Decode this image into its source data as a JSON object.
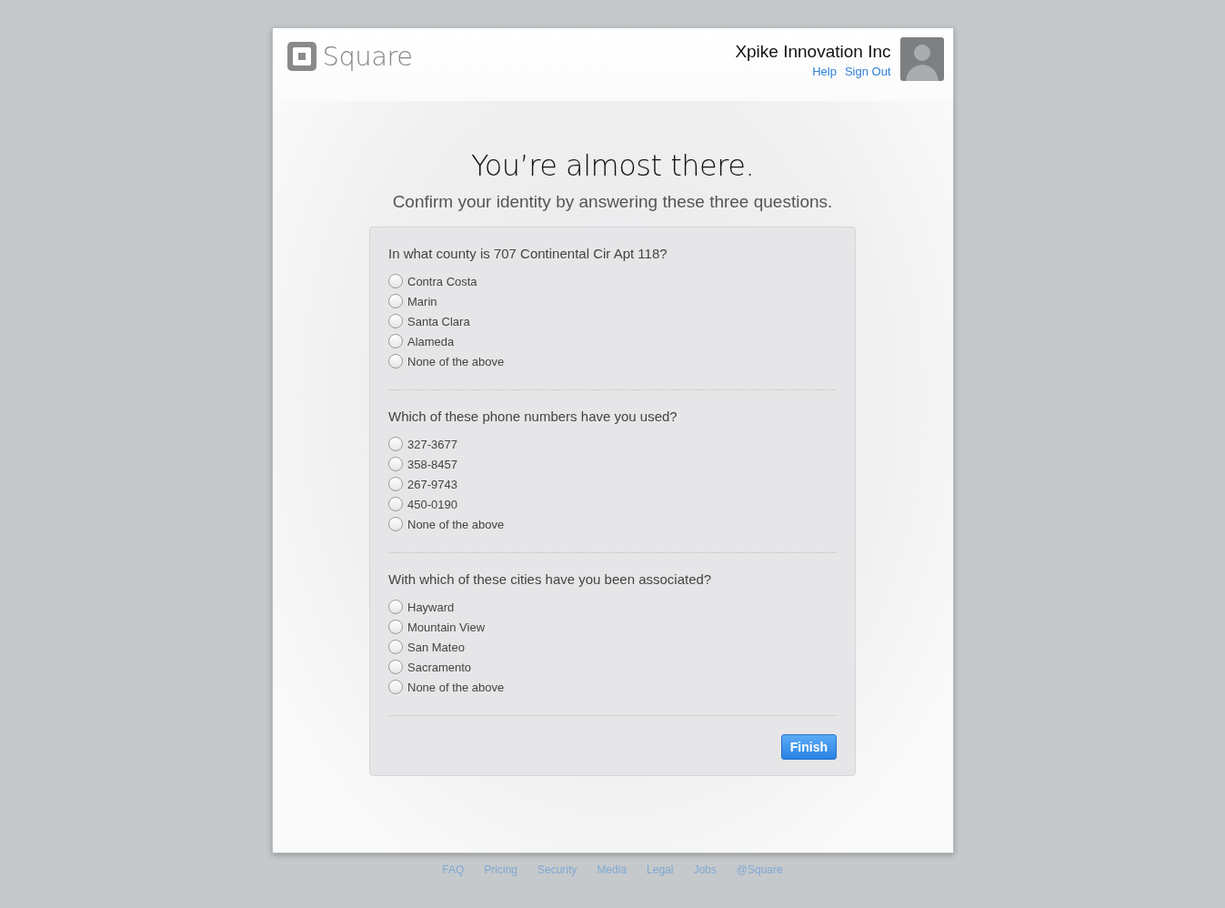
{
  "brand": {
    "name": "Square"
  },
  "account": {
    "name": "Xpike Innovation Inc",
    "links": [
      "Help",
      "Sign Out"
    ]
  },
  "heading": "You’re almost there.",
  "subheading": "Confirm your identity by answering these three questions.",
  "questions": [
    {
      "prompt": "In what county is 707 Continental Cir Apt 118?",
      "options": [
        {
          "label": "Contra Costa",
          "selected": false
        },
        {
          "label": "Marin",
          "selected": false
        },
        {
          "label": "Santa Clara",
          "selected": false
        },
        {
          "label": "Alameda",
          "selected": false
        },
        {
          "label": "None of the above",
          "selected": false
        }
      ]
    },
    {
      "prompt": "Which of these phone numbers have you used?",
      "options": [
        {
          "label": "327-3677",
          "selected": false
        },
        {
          "label": "358-8457",
          "selected": false
        },
        {
          "label": "267-9743",
          "selected": false
        },
        {
          "label": "450-0190",
          "selected": false
        },
        {
          "label": "None of the above",
          "selected": false
        }
      ]
    },
    {
      "prompt": "With which of these cities have you been associated?",
      "options": [
        {
          "label": "Hayward",
          "selected": false
        },
        {
          "label": "Mountain View",
          "selected": false
        },
        {
          "label": "San Mateo",
          "selected": false
        },
        {
          "label": "Sacramento",
          "selected": false
        },
        {
          "label": "None of the above",
          "selected": false
        }
      ]
    }
  ],
  "submit": "Finish",
  "footer": [
    "FAQ",
    "Pricing",
    "Security",
    "Media",
    "Legal",
    "Jobs",
    "@Square"
  ]
}
